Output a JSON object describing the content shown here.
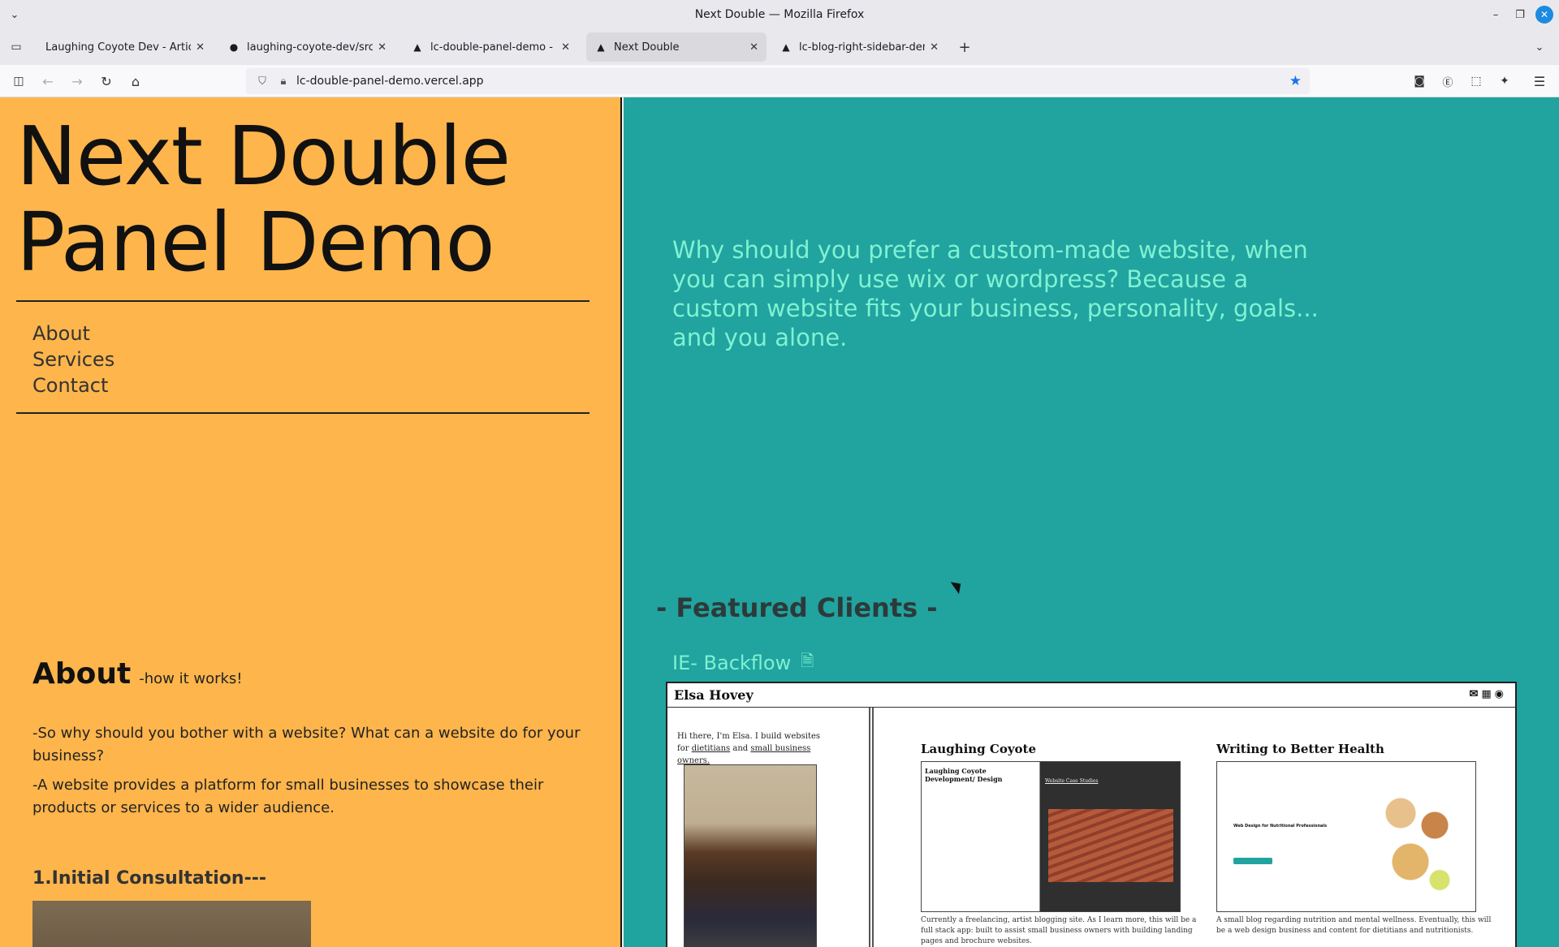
{
  "window": {
    "title": "Next Double — Mozilla Firefox"
  },
  "tabs": [
    {
      "label": "Laughing Coyote Dev - Articles,",
      "favicon": "lc-icon",
      "active": false
    },
    {
      "label": "laughing-coyote-dev/src/cor",
      "favicon": "github-icon",
      "active": false
    },
    {
      "label": "lc-double-panel-demo - Ove",
      "favicon": "vercel-icon",
      "active": false
    },
    {
      "label": "Next Double",
      "favicon": "vercel-icon",
      "active": true
    },
    {
      "label": "lc-blog-right-sidebar-demo-l",
      "favicon": "vercel-icon",
      "active": false
    }
  ],
  "urlbar": {
    "url": "lc-double-panel-demo.vercel.app"
  },
  "page": {
    "site_title_line1": "Next Double",
    "site_title_line2": "Panel Demo",
    "nav": [
      "About",
      "Services",
      "Contact"
    ],
    "intro": "Why should you prefer a custom-made website, when you can simply use wix or wordpress? Because a custom website fits your business, personality, goals... and you alone.",
    "featured_heading": "- Featured Clients -",
    "client_name": "IE- Backflow",
    "about_heading": "About",
    "about_sub": "-how it works!",
    "about_p1": "-So why should you bother with a website? What can a website do for your business?",
    "about_p2": "-A website provides a platform for small businesses to showcase their products or services to a wider audience.",
    "step1": "1.Initial Consultation---"
  },
  "embedded": {
    "name": "Elsa Hovey",
    "intro_prefix": "Hi there, I'm Elsa. I build websites for ",
    "link1": "dietitians",
    "intro_mid": " and ",
    "link2": "small business owners.",
    "card1_title": "Laughing Coyote",
    "card1_inner_title": "Laughing Coyote Development/ Design",
    "card1_inner_link": "Website Case Studies",
    "card1_desc": "Currently a freelancing, artist blogging site. As I learn more, this will be a full stack app: built to assist small business owners with building landing pages and brochure websites.",
    "card2_title": "Writing to Better Health",
    "card2_inner_text": "Web Design for Nutritional Professionals",
    "card2_desc": "A small blog regarding nutrition and mental wellness. Eventually, this will be a web design business and content for dietitians and nutritionists."
  },
  "colors": {
    "left_panel": "#fdb54c",
    "right_panel": "#21a39f",
    "intro_text": "#7ff2d2",
    "accent_blue": "#1a73e8"
  }
}
